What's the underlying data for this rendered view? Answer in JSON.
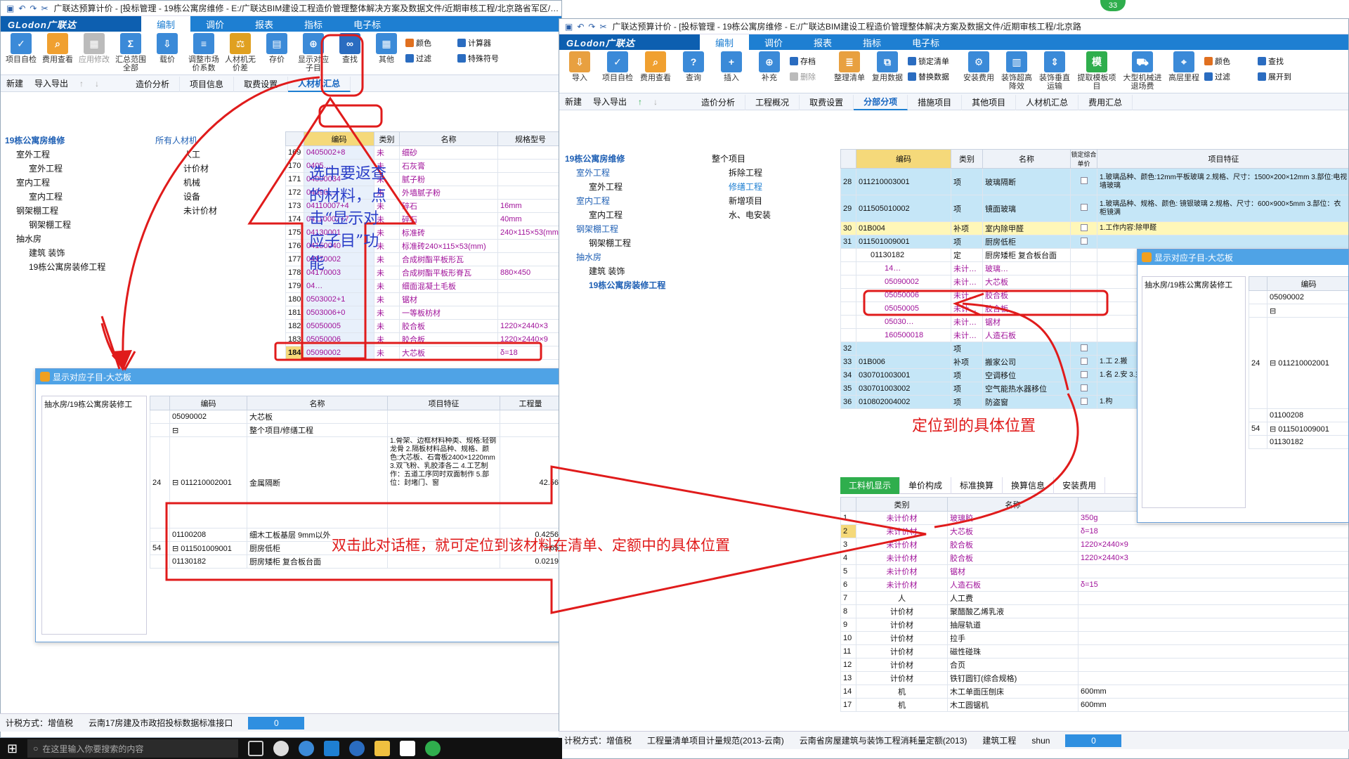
{
  "left_app": {
    "title": "广联达预算计价 - [投标管理 - 19栋公寓房维修 - E:/广联达BIM建设工程造价管理整体解决方案及数据文件/近期审核工程/北京路省军区/省军区GCCP5.0数据/近期工程/19栋公寓房维修.GBQ5]",
    "logo": "GLodon广联达",
    "menu": [
      "编制",
      "调价",
      "报表",
      "指标",
      "电子标"
    ],
    "ribbon": [
      "项目自检",
      "费用查看",
      "应用修改",
      "汇总范围全部",
      "载价",
      "调整市场价系数",
      "人材机无价差",
      "存价",
      "显示对应子目",
      "查找",
      "其他"
    ],
    "ribbon_small": [
      "颜色",
      "过滤",
      "计算器",
      "特殊符号"
    ],
    "toolrow": [
      "新建",
      "导入导出"
    ],
    "subtabs": [
      "造价分析",
      "项目信息",
      "取费设置",
      "人材机汇总"
    ],
    "tree": [
      "19栋公寓房维修",
      "室外工程",
      "室外工程",
      "室内工程",
      "室内工程",
      "钢架棚工程",
      "钢架棚工程",
      "抽水房",
      "建筑 装饰",
      "19栋公寓房装修工程"
    ],
    "rcj_tree": [
      "所有人材机",
      "人工",
      "计价材",
      "机械",
      "设备",
      "未计价材"
    ],
    "grid_headers": [
      "编码",
      "类别",
      "名称",
      "规格型号"
    ],
    "rows": [
      {
        "n": "169",
        "code": "0405002+8",
        "type": "未",
        "name": "细砂",
        "spec": ""
      },
      {
        "n": "170",
        "code": "0405…",
        "type": "未",
        "name": "石灰膏",
        "spec": ""
      },
      {
        "n": "171",
        "code": "04090034",
        "type": "未",
        "name": "腻子粉",
        "spec": ""
      },
      {
        "n": "172",
        "code": "04090…",
        "type": "未",
        "name": "外墙腻子粉",
        "spec": ""
      },
      {
        "n": "173",
        "code": "04110007+4",
        "type": "未",
        "name": "碎石",
        "spec": "16mm"
      },
      {
        "n": "174",
        "code": "04110007+7",
        "type": "未",
        "name": "碎石",
        "spec": "40mm"
      },
      {
        "n": "175",
        "code": "04130001",
        "type": "未",
        "name": "标准砖",
        "spec": "240×115×53(mm)"
      },
      {
        "n": "176",
        "code": "04150040",
        "type": "未",
        "name": "标准砖240×115×53(mm)",
        "spec": ""
      },
      {
        "n": "177",
        "code": "04170002",
        "type": "未",
        "name": "合成树酯平板形瓦",
        "spec": ""
      },
      {
        "n": "178",
        "code": "04170003",
        "type": "未",
        "name": "合成树酯平板形脊瓦",
        "spec": "880×450"
      },
      {
        "n": "179",
        "code": "04…",
        "type": "未",
        "name": "细面混凝土毛板",
        "spec": ""
      },
      {
        "n": "180",
        "code": "0503002+1",
        "type": "未",
        "name": "锯材",
        "spec": ""
      },
      {
        "n": "181",
        "code": "0503006+0",
        "type": "未",
        "name": "一等板枋材",
        "spec": ""
      },
      {
        "n": "182",
        "code": "05050005",
        "type": "未",
        "name": "胶合板",
        "spec": "1220×2440×3"
      },
      {
        "n": "183",
        "code": "05050006",
        "type": "未",
        "name": "胶合板",
        "spec": "1220×2440×9"
      },
      {
        "n": "184",
        "code": "05090002",
        "type": "未",
        "name": "大芯板",
        "spec": "δ=18"
      }
    ],
    "status": [
      "计税方式：增值税",
      "云南17房建及市政招投标数据标准接口"
    ],
    "progress": "0"
  },
  "left_dialog": {
    "title": "显示对应子目-大芯板",
    "tree": "抽水房/19栋公寓房装修工",
    "headers": [
      "编码",
      "名称",
      "项目特征",
      "工程量"
    ],
    "rows": [
      {
        "idx": "",
        "code": "05090002",
        "name": "大芯板",
        "feat": "",
        "qty": ""
      },
      {
        "idx": "",
        "code": "⊟",
        "name": "整个项目/修缮工程",
        "feat": "",
        "qty": ""
      },
      {
        "idx": "24",
        "code": "⊟ 011210002001",
        "name": "金属隔断",
        "feat": "1.骨架、边框材料种类、规格:轻钢龙骨 2.隔板材料品种、规格、颜色:大芯板、石膏板2400×1220mm 3.双飞粉、乳胶漆各二 4.工艺制作：五道工序同时双面制作 5.部位：封堵门、窗",
        "qty": "42.56"
      },
      {
        "idx": "",
        "code": "01100208",
        "name": "细木工板基层 9mm以外",
        "feat": "",
        "qty": "0.4256"
      },
      {
        "idx": "54",
        "code": "⊟ 011501009001",
        "name": "厨房低柜",
        "feat": "",
        "qty": "3.65"
      },
      {
        "idx": "",
        "code": "01130182",
        "name": "厨房矮柜 复合板台面",
        "feat": "",
        "qty": "0.0219"
      }
    ]
  },
  "right_app": {
    "title": "广联达预算计价 - [投标管理 - 19栋公寓房维修 - E:/广联达BIM建设工程造价管理整体解决方案及数据文件/近期审核工程/北京路",
    "badge": "33",
    "logo": "GLodon广联达",
    "menu": [
      "编制",
      "调价",
      "报表",
      "指标",
      "电子标"
    ],
    "ribbon": [
      "导入",
      "项目自检",
      "费用查看",
      "查询",
      "插入",
      "补充",
      "存档",
      "整理清单",
      "复用数据",
      "安装费用",
      "装饰超高降效",
      "装饰垂直运输",
      "提取模板项目",
      "大型机械进退场费",
      "高层里程"
    ],
    "ribbon_small": [
      "删除",
      "锁定清单",
      "替换数据",
      "颜色",
      "查找",
      "过滤",
      "展开到"
    ],
    "toolrow": [
      "新建",
      "导入导出"
    ],
    "subtabs": [
      "造价分析",
      "工程概况",
      "取费设置",
      "分部分项",
      "措施项目",
      "其他项目",
      "人材机汇总",
      "费用汇总"
    ],
    "tree": [
      "19栋公寓房维修",
      "室外工程",
      "室外工程",
      "室内工程",
      "室内工程",
      "钢架棚工程",
      "钢架棚工程",
      "抽水房",
      "建筑 装饰",
      "19栋公寓房装修工程"
    ],
    "sub_tree": [
      "整个项目",
      "拆除工程",
      "修缮工程",
      "新增项目",
      "水、电安装"
    ],
    "grid_headers": [
      "编码",
      "类别",
      "名称",
      "锁定综合单价",
      "项目特征"
    ],
    "rows": [
      {
        "n": "28",
        "code": "011210003001",
        "type": "项",
        "name": "玻璃隔断",
        "feat": "1.玻璃品种、颜色:12mm平板玻璃 2.规格、尺寸：1500×200×12mm 3.部位:电视墙玻璃",
        "cls": "blue-row"
      },
      {
        "n": "29",
        "code": "011505010002",
        "type": "项",
        "name": "镜面玻璃",
        "feat": "1.玻璃品种、规格、颜色: 镜银玻璃 2.规格、尺寸：600×900×5mm 3.部位：衣柜镜满",
        "cls": "blue-row"
      },
      {
        "n": "30",
        "code": "01B004",
        "type": "补项",
        "name": "室内除甲醛",
        "feat": "1.工作内容:除甲醛",
        "cls": "yel-row"
      },
      {
        "n": "31",
        "code": "011501009001",
        "type": "项",
        "name": "厨房低柜",
        "feat": "",
        "cls": "blue-row"
      },
      {
        "n": "",
        "code": "01130182",
        "type": "定",
        "name": "厨房矮柜 复合板台面",
        "feat": "",
        "cls": ""
      },
      {
        "n": "",
        "code": "14…",
        "type": "未计…",
        "name": "玻璃…",
        "feat": "",
        "cls": ""
      },
      {
        "n": "",
        "code": "05090002",
        "type": "未计…",
        "name": "大芯板",
        "feat": "",
        "cls": ""
      },
      {
        "n": "",
        "code": "05050006",
        "type": "未计…",
        "name": "胶合板",
        "feat": "",
        "cls": ""
      },
      {
        "n": "",
        "code": "05050005",
        "type": "未计…",
        "name": "胶合板",
        "feat": "",
        "cls": ""
      },
      {
        "n": "",
        "code": "05030…",
        "type": "未计…",
        "name": "锯材",
        "feat": "",
        "cls": ""
      },
      {
        "n": "",
        "code": "160500018",
        "type": "未计…",
        "name": "人造石板",
        "feat": "",
        "cls": ""
      },
      {
        "n": "32",
        "code": "",
        "type": "项",
        "name": "",
        "feat": "",
        "cls": "blue-row"
      },
      {
        "n": "33",
        "code": "01B006",
        "type": "补项",
        "name": "搬家公司",
        "feat": "1.工 2.搬",
        "cls": "blue-row"
      },
      {
        "n": "34",
        "code": "030701003001",
        "type": "项",
        "name": "空调移位",
        "feat": "1.名 2.安 3.主",
        "cls": "blue-row"
      },
      {
        "n": "35",
        "code": "030701003002",
        "type": "项",
        "name": "空气能热水器移位",
        "feat": "",
        "cls": "blue-row"
      },
      {
        "n": "36",
        "code": "010802004002",
        "type": "项",
        "name": "防盗窗",
        "feat": "1.构",
        "cls": "blue-row"
      }
    ],
    "bottom_tabs": [
      "工料机显示",
      "单价构成",
      "标准换算",
      "换算信息",
      "安装费用"
    ],
    "bottom_headers": [
      "类别",
      "名称",
      ""
    ],
    "bottom_rows": [
      {
        "n": "1",
        "type": "未计价材",
        "name": "玻璃胶",
        "spec": "350g"
      },
      {
        "n": "2",
        "type": "未计价材",
        "name": "大芯板",
        "spec": "δ=18"
      },
      {
        "n": "3",
        "type": "未计价材",
        "name": "胶合板",
        "spec": "1220×2440×9"
      },
      {
        "n": "4",
        "type": "未计价材",
        "name": "胶合板",
        "spec": "1220×2440×3"
      },
      {
        "n": "5",
        "type": "未计价材",
        "name": "锯材",
        "spec": ""
      },
      {
        "n": "6",
        "type": "未计价材",
        "name": "人造石板",
        "spec": "δ=15"
      },
      {
        "n": "7",
        "type": "人",
        "name": "人工费",
        "spec": ""
      },
      {
        "n": "8",
        "type": "计价材",
        "name": "聚醋酸乙烯乳液",
        "spec": ""
      },
      {
        "n": "9",
        "type": "计价材",
        "name": "抽屉轨道",
        "spec": ""
      },
      {
        "n": "10",
        "type": "计价材",
        "name": "拉手",
        "spec": ""
      },
      {
        "n": "11",
        "type": "计价材",
        "name": "磁性碰珠",
        "spec": ""
      },
      {
        "n": "12",
        "type": "计价材",
        "name": "合页",
        "spec": ""
      },
      {
        "n": "13",
        "type": "计价材",
        "name": "铁钉圆钉(综合规格)",
        "spec": ""
      },
      {
        "n": "14",
        "type": "机",
        "name": "木工单面压刨床",
        "spec": "600mm"
      },
      {
        "n": "17",
        "type": "机",
        "name": "木工圆锯机",
        "spec": "600mm"
      }
    ],
    "status": [
      "计税方式：增值税",
      "工程量清单项目计量规范(2013-云南)",
      "云南省房屋建筑与装饰工程消耗量定额(2013)",
      "建筑工程",
      "shun"
    ],
    "progress": "0"
  },
  "right_dialog": {
    "title": "显示对应子目-大芯板",
    "tree": "抽水房/19栋公寓房装修工",
    "header": "编码",
    "rows": [
      {
        "idx": "",
        "code": "05090002"
      },
      {
        "idx": "",
        "code": "⊟"
      },
      {
        "idx": "24",
        "code": "⊟ 011210002001"
      },
      {
        "idx": "",
        "code": "01100208"
      },
      {
        "idx": "54",
        "code": "⊟ 011501009001"
      },
      {
        "idx": "",
        "code": "01130182"
      }
    ]
  },
  "annotations": {
    "a1": "选中要返查的材料，点击“显示对应子目”功能",
    "a2": "定位到的具体位置",
    "a3": "双击此对话框，就可定位到该材料在清单、定额中的具体位置"
  },
  "taskbar": {
    "search": "在这里输入你要搜索的内容"
  },
  "colors": {
    "accent": "#1e7fd2",
    "annotation": "#e01b1b",
    "purple_text": "#a0129a"
  }
}
